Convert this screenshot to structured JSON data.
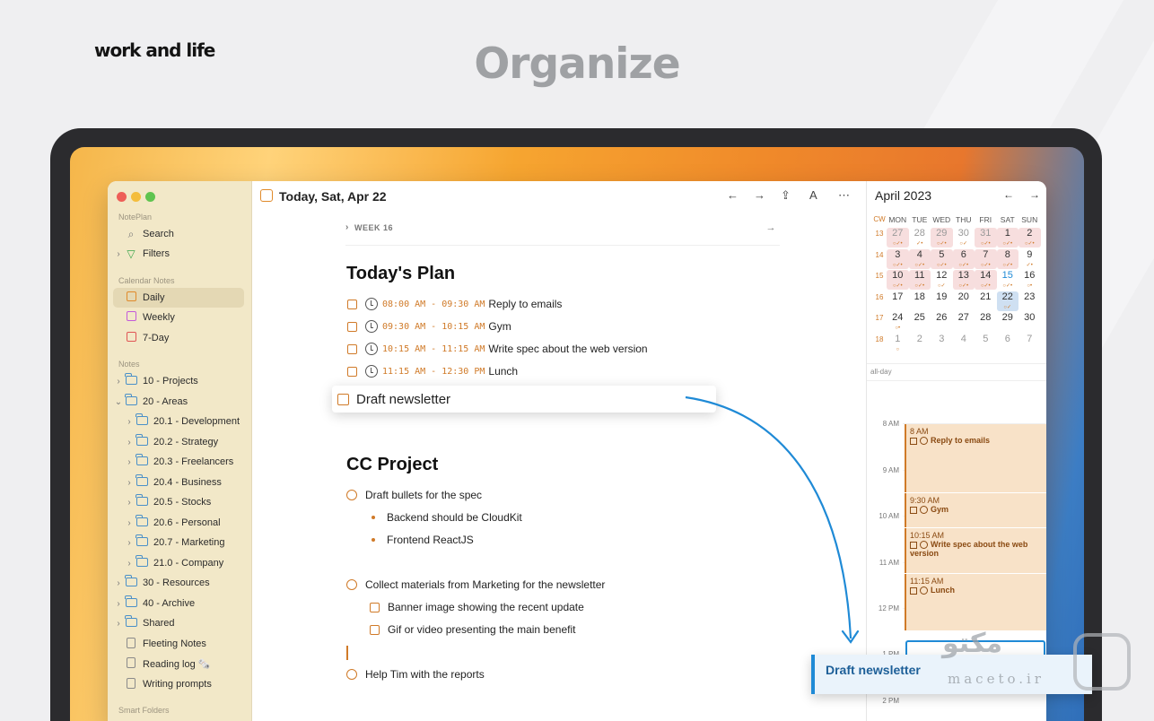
{
  "headline": {
    "part1": "Organize",
    "part2": "work and life"
  },
  "sidebar": {
    "app_label": "NotePlan",
    "search": "Search",
    "filters": "Filters",
    "calendar_section": "Calendar Notes",
    "daily": "Daily",
    "weekly": "Weekly",
    "seven_day": "7-Day",
    "notes_section": "Notes",
    "folders": [
      "10 - Projects",
      "20 - Areas",
      "20.1 - Development",
      "20.2 - Strategy",
      "20.3 - Freelancers",
      "20.4 - Business",
      "20.5 - Stocks",
      "20.6 - Personal",
      "20.7 - Marketing",
      "21.0 - Company",
      "30 - Resources",
      "40 - Archive",
      "Shared"
    ],
    "notes": [
      "Fleeting Notes",
      "Reading log 🗞️",
      "Writing prompts"
    ],
    "smart_section": "Smart Folders"
  },
  "main": {
    "title": "Today, Sat, Apr 22",
    "week_label": "WEEK 16",
    "plan_heading": "Today's Plan",
    "tasks": [
      {
        "time": "08:00 AM - 09:30 AM",
        "text": "Reply to emails"
      },
      {
        "time": "09:30 AM - 10:15 AM",
        "text": "Gym"
      },
      {
        "time": "10:15 AM - 11:15 AM",
        "text": "Write spec about the web version"
      },
      {
        "time": "11:15 AM - 12:30 PM",
        "text": "Lunch"
      }
    ],
    "dragging_task": "Draft newsletter",
    "project_heading": "CC Project",
    "project_items": {
      "item1": "Draft bullets for the spec",
      "bullet1": "Backend should be CloudKit",
      "bullet2": "Frontend ReactJS",
      "item2": "Collect materials from Marketing for the newsletter",
      "sub1": "Banner image showing the recent update",
      "sub2": "Gif or video presenting the main benefit",
      "item3": "Help Tim with the reports"
    }
  },
  "calendar": {
    "month": "April 2023",
    "headers": [
      "CW",
      "MON",
      "TUE",
      "WED",
      "THU",
      "FRI",
      "SAT",
      "SUN"
    ],
    "weeks": [
      {
        "cw": "13",
        "days": [
          "27",
          "28",
          "29",
          "30",
          "31",
          "1",
          "2"
        ]
      },
      {
        "cw": "14",
        "days": [
          "3",
          "4",
          "5",
          "6",
          "7",
          "8",
          "9"
        ]
      },
      {
        "cw": "15",
        "days": [
          "10",
          "11",
          "12",
          "13",
          "14",
          "15",
          "16"
        ]
      },
      {
        "cw": "16",
        "days": [
          "17",
          "18",
          "19",
          "20",
          "21",
          "22",
          "23"
        ]
      },
      {
        "cw": "17",
        "days": [
          "24",
          "25",
          "26",
          "27",
          "28",
          "29",
          "30"
        ]
      },
      {
        "cw": "18",
        "days": [
          "1",
          "2",
          "3",
          "4",
          "5",
          "6",
          "7"
        ]
      }
    ],
    "all_day": "all-day",
    "hours": [
      "8 AM",
      "9 AM",
      "10 AM",
      "11 AM",
      "12 PM",
      "1 PM",
      "2 PM"
    ],
    "events": [
      {
        "time": "8 AM",
        "title": "Reply to emails"
      },
      {
        "time": "9:30 AM",
        "title": "Gym"
      },
      {
        "time": "10:15 AM",
        "title": "Write spec about the web version"
      },
      {
        "time": "11:15 AM",
        "title": "Lunch"
      }
    ],
    "drop_card": "Draft newsletter"
  },
  "watermark": {
    "text": "مکتو",
    "sub": "maceto.ir"
  },
  "colors": {
    "accent": "#d07a28",
    "blue": "#1f8ad6",
    "sidebar": "#f2e8c8"
  }
}
